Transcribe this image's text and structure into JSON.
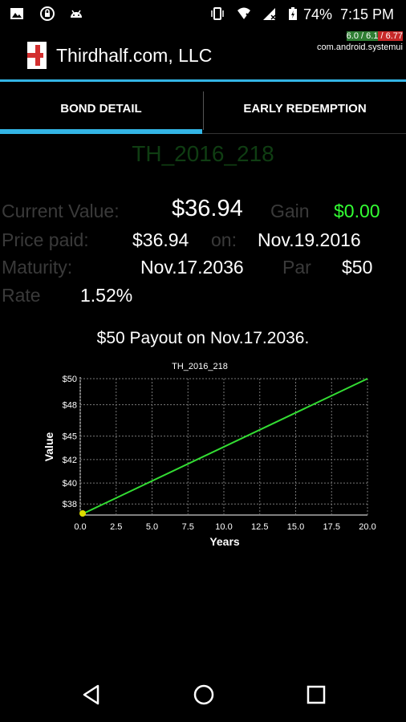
{
  "status_bar": {
    "battery": "74%",
    "time": "7:15 PM",
    "load_parts": [
      "6.0 / 6.1",
      " / 6.77"
    ],
    "process": "com.android.systemui"
  },
  "app_bar": {
    "title": "Thirdhalf.com, LLC"
  },
  "tabs": [
    {
      "label": "BOND DETAIL",
      "selected": true
    },
    {
      "label": "EARLY REDEMPTION",
      "selected": false
    }
  ],
  "bond": {
    "name": "TH_2016_218",
    "current_value_label": "Current Value:",
    "current_value": "$36.94",
    "gain_label": "Gain",
    "gain": "$0.00",
    "price_paid_label": "Price paid:",
    "price_paid": "$36.94",
    "on_label": "on:",
    "purchase_date": "Nov.19.2016",
    "maturity_label": "Maturity:",
    "maturity": "Nov.17.2036",
    "par_label": "Par",
    "par": "$50",
    "rate_label": "Rate",
    "rate": "1.52%"
  },
  "chart_heading": "$50 Payout on Nov.17.2036.",
  "chart_data": {
    "type": "line",
    "title": "TH_2016_218",
    "xlabel": "Years",
    "ylabel": "Value",
    "xlim": [
      0,
      20
    ],
    "ylim": [
      36.94,
      50
    ],
    "x_ticks": [
      "0.0",
      "2.5",
      "5.0",
      "7.5",
      "10.0",
      "12.5",
      "15.0",
      "17.5",
      "20.0"
    ],
    "y_ticks": [
      "$38",
      "$40",
      "$42",
      "$45",
      "$48",
      "$50"
    ],
    "series": [
      {
        "color": "#33dd33",
        "x": [
          0,
          20
        ],
        "y": [
          36.94,
          50
        ]
      }
    ],
    "marker": {
      "x": 0,
      "y": 36.94,
      "color": "#dddd00"
    },
    "grid": true
  },
  "colors": {
    "accent": "#33b5e5",
    "gain": "#33ff33",
    "bond_name": "#0f3d12"
  },
  "icons": [
    "image-icon",
    "lock-icon",
    "android-icon",
    "vibrate-icon",
    "wifi-icon",
    "signal-icon",
    "battery-icon",
    "app-logo-icon",
    "back-icon",
    "home-icon",
    "recents-icon"
  ]
}
